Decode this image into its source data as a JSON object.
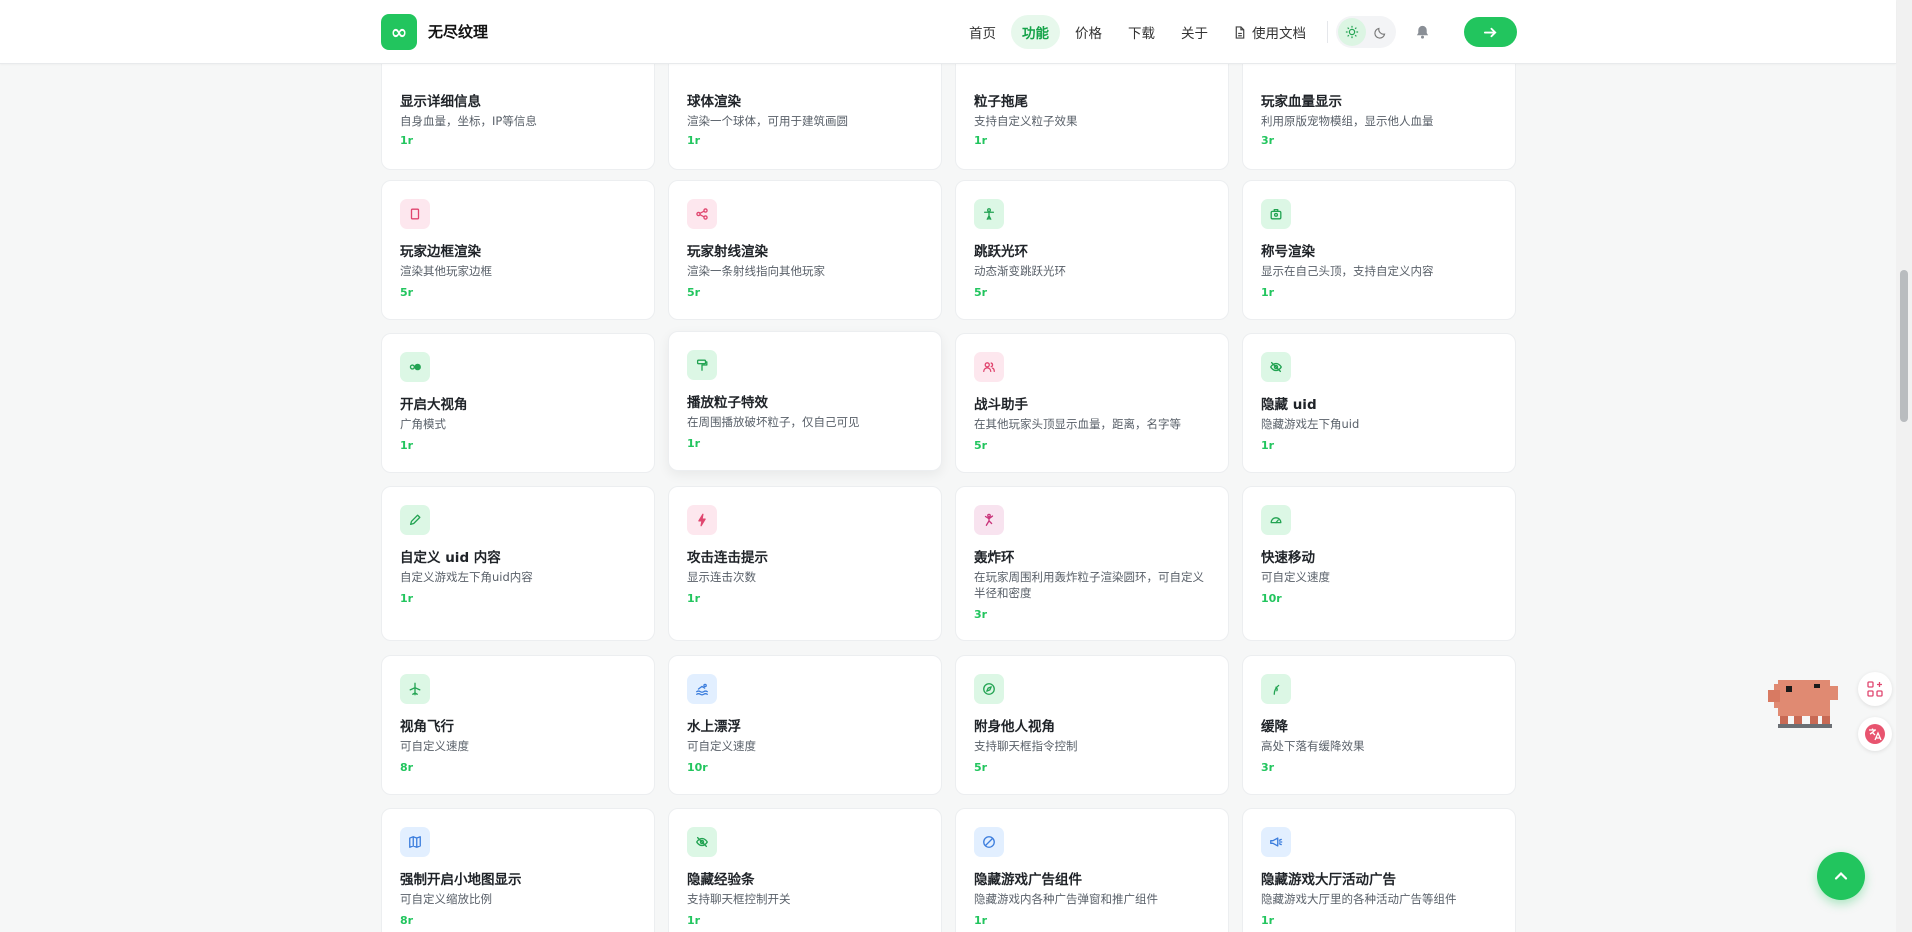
{
  "header": {
    "logo_glyph": "∞",
    "site_name": "无尽纹理",
    "nav": [
      {
        "label": "首页"
      },
      {
        "label": "功能"
      },
      {
        "label": "价格"
      },
      {
        "label": "下载"
      },
      {
        "label": "关于"
      },
      {
        "label": "使用文档"
      }
    ],
    "active_nav": "功能",
    "accent": "#22c55e"
  },
  "features": [
    {
      "title": "显示详细信息",
      "desc": "自身血量，坐标，IP等信息",
      "price": "1r",
      "icon": "info-icon",
      "color": "b"
    },
    {
      "title": "球体渲染",
      "desc": "渲染一个球体，可用于建筑画圆",
      "price": "1r",
      "icon": "sphere-icon",
      "color": "b"
    },
    {
      "title": "粒子拖尾",
      "desc": "支持自定义粒子效果",
      "price": "1r",
      "icon": "sparkle-icon",
      "color": "g"
    },
    {
      "title": "玩家血量显示",
      "desc": "利用原版宠物模组，显示他人血量",
      "price": "3r",
      "icon": "heart-icon",
      "color": "r"
    },
    {
      "title": "玩家边框渲染",
      "desc": "渲染其他玩家边框",
      "price": "5r",
      "icon": "frame-icon",
      "color": "r"
    },
    {
      "title": "玩家射线渲染",
      "desc": "渲染一条射线指向其他玩家",
      "price": "5r",
      "icon": "share-icon",
      "color": "r"
    },
    {
      "title": "跳跃光环",
      "desc": "动态渐变跳跃光环",
      "price": "5r",
      "icon": "person-icon",
      "color": "g"
    },
    {
      "title": "称号渲染",
      "desc": "显示在自己头顶，支持自定义内容",
      "price": "1r",
      "icon": "badge-icon",
      "color": "g"
    },
    {
      "title": "开启大视角",
      "desc": "广角模式",
      "price": "1r",
      "icon": "toggle-icon",
      "color": "g"
    },
    {
      "title": "播放粒子特效",
      "desc": "在周围播放破坏粒子，仅自己可见",
      "price": "1r",
      "icon": "paint-roller-icon",
      "color": "g"
    },
    {
      "title": "战斗助手",
      "desc": "在其他玩家头顶显示血量，距离，名字等",
      "price": "5r",
      "icon": "users-icon",
      "color": "r"
    },
    {
      "title": "隐藏 uid",
      "desc": "隐藏游戏左下角uid",
      "price": "1r",
      "icon": "eye-off-icon",
      "color": "g"
    },
    {
      "title": "自定义 uid 内容",
      "desc": "自定义游戏左下角uid内容",
      "price": "1r",
      "icon": "pencil-icon",
      "color": "g"
    },
    {
      "title": "攻击连击提示",
      "desc": "显示连击次数",
      "price": "1r",
      "icon": "bolt-icon",
      "color": "r"
    },
    {
      "title": "轰炸环",
      "desc": "在玩家周围利用轰炸粒子渲染圆环，可自定义半径和密度",
      "price": "3r",
      "icon": "explosion-icon",
      "color": "p"
    },
    {
      "title": "快速移动",
      "desc": "可自定义速度",
      "price": "10r",
      "icon": "gauge-icon",
      "color": "g"
    },
    {
      "title": "视角飞行",
      "desc": "可自定义速度",
      "price": "8r",
      "icon": "plane-icon",
      "color": "g"
    },
    {
      "title": "水上漂浮",
      "desc": "可自定义速度",
      "price": "10r",
      "icon": "swim-icon",
      "color": "b"
    },
    {
      "title": "附身他人视角",
      "desc": "支持聊天框指令控制",
      "price": "5r",
      "icon": "compass-icon",
      "color": "g"
    },
    {
      "title": "缓降",
      "desc": "高处下落有缓降效果",
      "price": "3r",
      "icon": "feather-icon",
      "color": "g"
    },
    {
      "title": "强制开启小地图显示",
      "desc": "可自定义缩放比例",
      "price": "8r",
      "icon": "map-icon",
      "color": "b"
    },
    {
      "title": "隐藏经验条",
      "desc": "支持聊天框控制开关",
      "price": "1r",
      "icon": "eye-off-icon",
      "color": "g"
    },
    {
      "title": "隐藏游戏广告组件",
      "desc": "隐藏游戏内各种广告弹窗和推广组件",
      "price": "1r",
      "icon": "ban-icon",
      "color": "b"
    },
    {
      "title": "隐藏游戏大厅活动广告",
      "desc": "隐藏游戏大厅里的各种活动广告等组件",
      "price": "1r",
      "icon": "megaphone-icon",
      "color": "b"
    }
  ]
}
